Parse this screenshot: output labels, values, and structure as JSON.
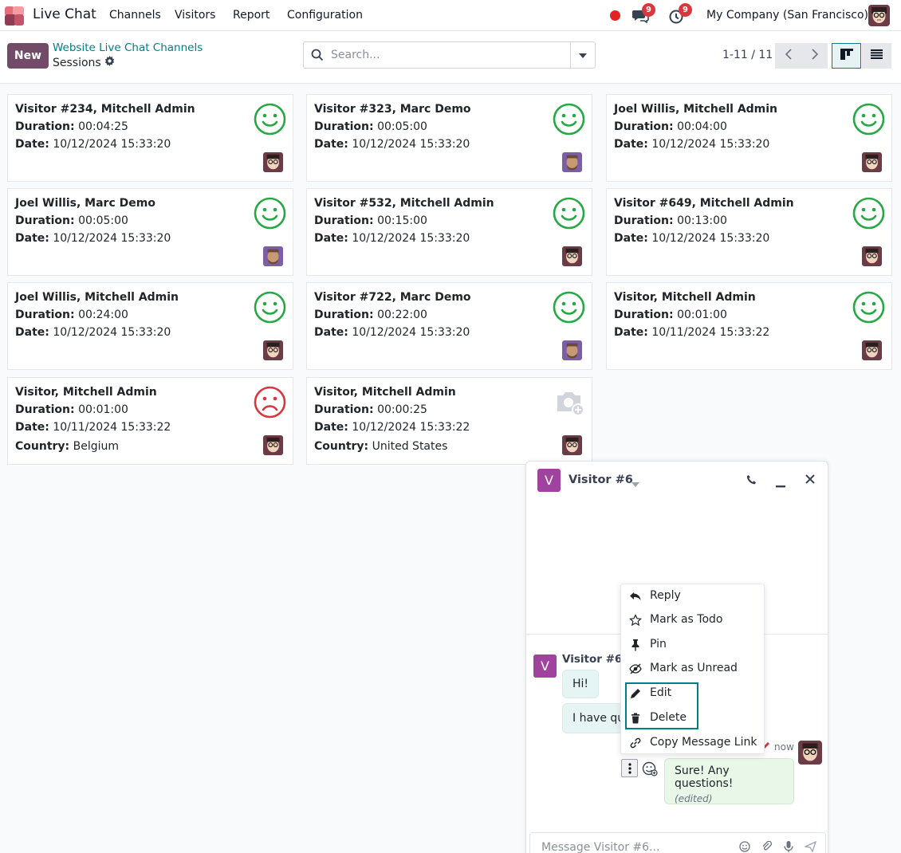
{
  "navbar": {
    "app_name": "Live Chat",
    "menu": [
      "Channels",
      "Visitors",
      "Report",
      "Configuration"
    ],
    "messages_badge": "9",
    "activities_badge": "9",
    "company": "My Company (San Francisco)"
  },
  "control_panel": {
    "new_label": "New",
    "breadcrumb_parent": "Website Live Chat Channels",
    "breadcrumb_current": "Sessions",
    "search_placeholder": "Search...",
    "pager": "1-11 / 11"
  },
  "cards": [
    {
      "title": "Visitor #234, Mitchell Admin",
      "duration": "00:04:25",
      "date": "10/12/2024 15:33:20",
      "rating": "happy",
      "avatar": "mitchell"
    },
    {
      "title": "Visitor #323, Marc Demo",
      "duration": "00:05:00",
      "date": "10/12/2024 15:33:20",
      "rating": "happy",
      "avatar": "marc"
    },
    {
      "title": "Joel Willis, Mitchell Admin",
      "duration": "00:04:00",
      "date": "10/12/2024 15:33:20",
      "rating": "happy",
      "avatar": "mitchell"
    },
    {
      "title": "Joel Willis, Marc Demo",
      "duration": "00:05:00",
      "date": "10/12/2024 15:33:20",
      "rating": "happy",
      "avatar": "marc"
    },
    {
      "title": "Visitor #532, Mitchell Admin",
      "duration": "00:15:00",
      "date": "10/12/2024 15:33:20",
      "rating": "happy",
      "avatar": "mitchell"
    },
    {
      "title": "Visitor #649, Mitchell Admin",
      "duration": "00:13:00",
      "date": "10/12/2024 15:33:20",
      "rating": "happy",
      "avatar": "mitchell"
    },
    {
      "title": "Joel Willis, Mitchell Admin",
      "duration": "00:24:00",
      "date": "10/12/2024 15:33:20",
      "rating": "happy",
      "avatar": "mitchell"
    },
    {
      "title": "Visitor #722, Marc Demo",
      "duration": "00:22:00",
      "date": "10/12/2024 15:33:20",
      "rating": "happy",
      "avatar": "marc"
    },
    {
      "title": "Visitor, Mitchell Admin",
      "duration": "00:01:00",
      "date": "10/11/2024 15:33:22",
      "rating": "happy",
      "avatar": "mitchell"
    },
    {
      "title": "Visitor, Mitchell Admin",
      "duration": "00:01:00",
      "date": "10/11/2024 15:33:22",
      "country": "Belgium",
      "rating": "sad",
      "avatar": "mitchell"
    },
    {
      "title": "Visitor, Mitchell Admin",
      "duration": "00:00:25",
      "date": "10/12/2024 15:33:22",
      "country": "United States",
      "rating": "none",
      "avatar": "mitchell"
    }
  ],
  "labels": {
    "duration": "Duration:",
    "date": "Date:",
    "country": "Country:"
  },
  "chat": {
    "avatar_letter": "V",
    "title": "Visitor #6",
    "author": "Visitor #6 -",
    "msg1": "Hi!",
    "msg2": "I have qu",
    "timestamp": "now",
    "reply": "Sure! Any questions!",
    "edited": "(edited)",
    "composer_placeholder": "Message Visitor #6..."
  },
  "context_menu": [
    "Reply",
    "Mark as Todo",
    "Pin",
    "Mark as Unread",
    "Edit",
    "Delete",
    "Copy Message Link"
  ],
  "colors": {
    "primary": "#714b67",
    "accent": "#017e84",
    "happy": "#28a745",
    "sad": "#d9363e"
  }
}
